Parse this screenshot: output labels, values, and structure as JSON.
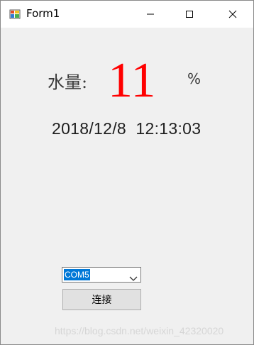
{
  "window": {
    "title": "Form1",
    "icon": "winforms-app-icon",
    "controls": {
      "minimize_icon": "minimize-icon",
      "maximize_icon": "maximize-icon",
      "close_icon": "close-icon"
    }
  },
  "main": {
    "water_label": "水量:",
    "water_value": "11",
    "unit": "%",
    "datetime": "2018/12/8  12:13:03"
  },
  "port_select": {
    "selected": "COM5",
    "arrow_icon": "chevron-down-icon"
  },
  "connect_button": {
    "label": "连接"
  },
  "watermark": "https://blog.csdn.net/weixin_42320020",
  "colors": {
    "value": "#ff0000",
    "selection": "#0078d7",
    "background": "#f0f0f0"
  }
}
